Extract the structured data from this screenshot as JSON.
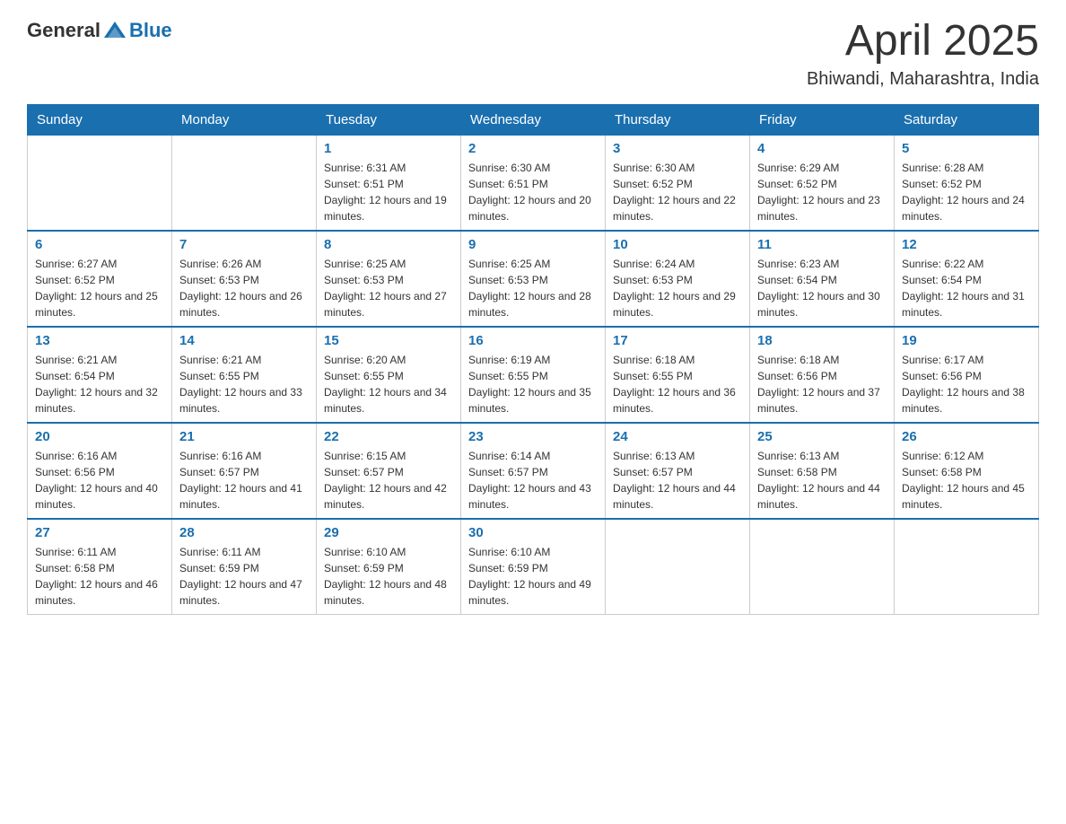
{
  "header": {
    "logo_general": "General",
    "logo_blue": "Blue",
    "title": "April 2025",
    "subtitle": "Bhiwandi, Maharashtra, India"
  },
  "days_of_week": [
    "Sunday",
    "Monday",
    "Tuesday",
    "Wednesday",
    "Thursday",
    "Friday",
    "Saturday"
  ],
  "weeks": [
    [
      {
        "day": "",
        "sunrise": "",
        "sunset": "",
        "daylight": ""
      },
      {
        "day": "",
        "sunrise": "",
        "sunset": "",
        "daylight": ""
      },
      {
        "day": "1",
        "sunrise": "Sunrise: 6:31 AM",
        "sunset": "Sunset: 6:51 PM",
        "daylight": "Daylight: 12 hours and 19 minutes."
      },
      {
        "day": "2",
        "sunrise": "Sunrise: 6:30 AM",
        "sunset": "Sunset: 6:51 PM",
        "daylight": "Daylight: 12 hours and 20 minutes."
      },
      {
        "day": "3",
        "sunrise": "Sunrise: 6:30 AM",
        "sunset": "Sunset: 6:52 PM",
        "daylight": "Daylight: 12 hours and 22 minutes."
      },
      {
        "day": "4",
        "sunrise": "Sunrise: 6:29 AM",
        "sunset": "Sunset: 6:52 PM",
        "daylight": "Daylight: 12 hours and 23 minutes."
      },
      {
        "day": "5",
        "sunrise": "Sunrise: 6:28 AM",
        "sunset": "Sunset: 6:52 PM",
        "daylight": "Daylight: 12 hours and 24 minutes."
      }
    ],
    [
      {
        "day": "6",
        "sunrise": "Sunrise: 6:27 AM",
        "sunset": "Sunset: 6:52 PM",
        "daylight": "Daylight: 12 hours and 25 minutes."
      },
      {
        "day": "7",
        "sunrise": "Sunrise: 6:26 AM",
        "sunset": "Sunset: 6:53 PM",
        "daylight": "Daylight: 12 hours and 26 minutes."
      },
      {
        "day": "8",
        "sunrise": "Sunrise: 6:25 AM",
        "sunset": "Sunset: 6:53 PM",
        "daylight": "Daylight: 12 hours and 27 minutes."
      },
      {
        "day": "9",
        "sunrise": "Sunrise: 6:25 AM",
        "sunset": "Sunset: 6:53 PM",
        "daylight": "Daylight: 12 hours and 28 minutes."
      },
      {
        "day": "10",
        "sunrise": "Sunrise: 6:24 AM",
        "sunset": "Sunset: 6:53 PM",
        "daylight": "Daylight: 12 hours and 29 minutes."
      },
      {
        "day": "11",
        "sunrise": "Sunrise: 6:23 AM",
        "sunset": "Sunset: 6:54 PM",
        "daylight": "Daylight: 12 hours and 30 minutes."
      },
      {
        "day": "12",
        "sunrise": "Sunrise: 6:22 AM",
        "sunset": "Sunset: 6:54 PM",
        "daylight": "Daylight: 12 hours and 31 minutes."
      }
    ],
    [
      {
        "day": "13",
        "sunrise": "Sunrise: 6:21 AM",
        "sunset": "Sunset: 6:54 PM",
        "daylight": "Daylight: 12 hours and 32 minutes."
      },
      {
        "day": "14",
        "sunrise": "Sunrise: 6:21 AM",
        "sunset": "Sunset: 6:55 PM",
        "daylight": "Daylight: 12 hours and 33 minutes."
      },
      {
        "day": "15",
        "sunrise": "Sunrise: 6:20 AM",
        "sunset": "Sunset: 6:55 PM",
        "daylight": "Daylight: 12 hours and 34 minutes."
      },
      {
        "day": "16",
        "sunrise": "Sunrise: 6:19 AM",
        "sunset": "Sunset: 6:55 PM",
        "daylight": "Daylight: 12 hours and 35 minutes."
      },
      {
        "day": "17",
        "sunrise": "Sunrise: 6:18 AM",
        "sunset": "Sunset: 6:55 PM",
        "daylight": "Daylight: 12 hours and 36 minutes."
      },
      {
        "day": "18",
        "sunrise": "Sunrise: 6:18 AM",
        "sunset": "Sunset: 6:56 PM",
        "daylight": "Daylight: 12 hours and 37 minutes."
      },
      {
        "day": "19",
        "sunrise": "Sunrise: 6:17 AM",
        "sunset": "Sunset: 6:56 PM",
        "daylight": "Daylight: 12 hours and 38 minutes."
      }
    ],
    [
      {
        "day": "20",
        "sunrise": "Sunrise: 6:16 AM",
        "sunset": "Sunset: 6:56 PM",
        "daylight": "Daylight: 12 hours and 40 minutes."
      },
      {
        "day": "21",
        "sunrise": "Sunrise: 6:16 AM",
        "sunset": "Sunset: 6:57 PM",
        "daylight": "Daylight: 12 hours and 41 minutes."
      },
      {
        "day": "22",
        "sunrise": "Sunrise: 6:15 AM",
        "sunset": "Sunset: 6:57 PM",
        "daylight": "Daylight: 12 hours and 42 minutes."
      },
      {
        "day": "23",
        "sunrise": "Sunrise: 6:14 AM",
        "sunset": "Sunset: 6:57 PM",
        "daylight": "Daylight: 12 hours and 43 minutes."
      },
      {
        "day": "24",
        "sunrise": "Sunrise: 6:13 AM",
        "sunset": "Sunset: 6:57 PM",
        "daylight": "Daylight: 12 hours and 44 minutes."
      },
      {
        "day": "25",
        "sunrise": "Sunrise: 6:13 AM",
        "sunset": "Sunset: 6:58 PM",
        "daylight": "Daylight: 12 hours and 44 minutes."
      },
      {
        "day": "26",
        "sunrise": "Sunrise: 6:12 AM",
        "sunset": "Sunset: 6:58 PM",
        "daylight": "Daylight: 12 hours and 45 minutes."
      }
    ],
    [
      {
        "day": "27",
        "sunrise": "Sunrise: 6:11 AM",
        "sunset": "Sunset: 6:58 PM",
        "daylight": "Daylight: 12 hours and 46 minutes."
      },
      {
        "day": "28",
        "sunrise": "Sunrise: 6:11 AM",
        "sunset": "Sunset: 6:59 PM",
        "daylight": "Daylight: 12 hours and 47 minutes."
      },
      {
        "day": "29",
        "sunrise": "Sunrise: 6:10 AM",
        "sunset": "Sunset: 6:59 PM",
        "daylight": "Daylight: 12 hours and 48 minutes."
      },
      {
        "day": "30",
        "sunrise": "Sunrise: 6:10 AM",
        "sunset": "Sunset: 6:59 PM",
        "daylight": "Daylight: 12 hours and 49 minutes."
      },
      {
        "day": "",
        "sunrise": "",
        "sunset": "",
        "daylight": ""
      },
      {
        "day": "",
        "sunrise": "",
        "sunset": "",
        "daylight": ""
      },
      {
        "day": "",
        "sunrise": "",
        "sunset": "",
        "daylight": ""
      }
    ]
  ]
}
